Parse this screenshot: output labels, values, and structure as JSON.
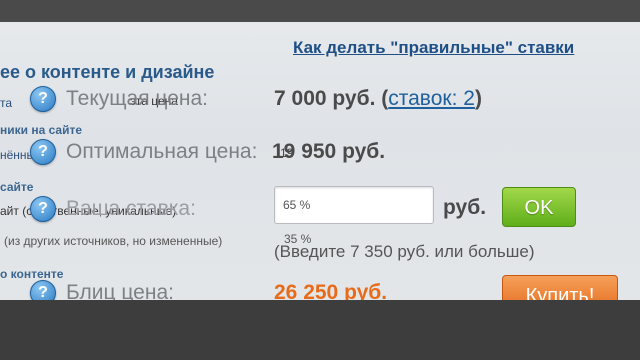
{
  "help_link": "Как делать \"правильные\" ставки",
  "section_title": "ее о контенте и дизайне",
  "ghost_text": {
    "row1_left": "та",
    "row1_overlap": "эта цена",
    "row2_left": "ники на сайте",
    "row3_left": "нённые",
    "row3_overlap": "19",
    "row4_left": "сайте",
    "row5_left": "айт (собственные, уникальные)",
    "row6_left": "(из других источников, но измененные)",
    "row6_pct": "35 %",
    "row7_left": "о контенте"
  },
  "fields": {
    "current_price": {
      "label": "Текущая цена:",
      "value": "7 000 руб. (",
      "bids_link": "ставок: 2",
      "close": ")"
    },
    "optimal_price": {
      "label": "Оптимальная цена:",
      "value": "19 950 руб."
    },
    "your_bid": {
      "label": "Ваша ставка:",
      "input_value": "65 %",
      "currency": "руб.",
      "ok_button": "OK",
      "hint": "(Введите 7 350 руб. или больше)"
    },
    "blitz_price": {
      "label": "Блиц цена:",
      "value": "26 250 руб.",
      "buy_button": "Купить!"
    }
  },
  "colors": {
    "orange": "#e76b1a",
    "link": "#1e5f9e",
    "ok_green": "#6cb824"
  },
  "icons": {
    "help": "question-mark-circle"
  }
}
